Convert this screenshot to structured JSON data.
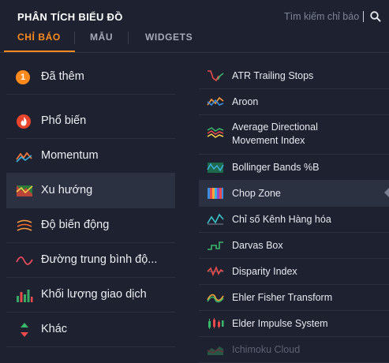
{
  "header": {
    "title": "PHÂN TÍCH BIỂU ĐỒ",
    "search_placeholder": "Tìm kiếm chỉ báo"
  },
  "tabs": [
    {
      "label": "CHỈ BÁO",
      "active": true
    },
    {
      "label": "MẪU",
      "active": false
    },
    {
      "label": "WIDGETS",
      "active": false
    }
  ],
  "categories": {
    "added": {
      "label": "Đã thêm",
      "count": "1"
    },
    "items": [
      {
        "label": "Phổ biến",
        "icon": "flame-icon"
      },
      {
        "label": "Momentum",
        "icon": "momentum-icon"
      },
      {
        "label": "Xu hướng",
        "icon": "trend-icon",
        "active": true
      },
      {
        "label": "Độ biến động",
        "icon": "volatility-icon"
      },
      {
        "label": "Đường trung bình độ...",
        "icon": "moving-average-icon"
      },
      {
        "label": "Khối lượng giao dịch",
        "icon": "volume-icon"
      },
      {
        "label": "Khác",
        "icon": "other-icon"
      }
    ]
  },
  "indicators": [
    {
      "label": "ATR Trailing Stops",
      "icon": "atr-trailing-stops-icon"
    },
    {
      "label": "Aroon",
      "icon": "aroon-icon"
    },
    {
      "label": "Average Directional",
      "label2": "Movement Index",
      "icon": "adx-icon"
    },
    {
      "label": "Bollinger Bands %B",
      "icon": "bollinger-icon"
    },
    {
      "label": "Chop Zone",
      "icon": "chop-zone-icon",
      "active": true
    },
    {
      "label": "Chỉ số Kênh Hàng hóa",
      "icon": "cci-icon"
    },
    {
      "label": "Darvas Box",
      "icon": "darvas-box-icon"
    },
    {
      "label": "Disparity Index",
      "icon": "disparity-icon"
    },
    {
      "label": "Ehler Fisher Transform",
      "icon": "fisher-icon"
    },
    {
      "label": "Elder Impulse System",
      "icon": "elder-impulse-icon"
    },
    {
      "label": "Ichimoku Cloud",
      "icon": "ichimoku-icon"
    }
  ],
  "colors": {
    "accent": "#ff8a1c",
    "background": "#1e2230",
    "active_row": "#2c3142"
  }
}
